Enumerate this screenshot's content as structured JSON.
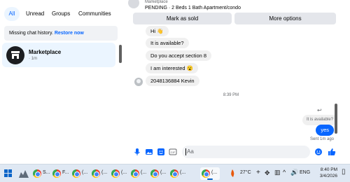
{
  "filters": {
    "all": "All",
    "unread": "Unread",
    "groups": "Groups",
    "communities": "Communities"
  },
  "notice": {
    "text": "Missing chat history.",
    "link": "Restore now"
  },
  "conversation": {
    "name": "Marketplace",
    "time": "· 1m"
  },
  "chat": {
    "title": "Marketplace",
    "listing": "PENDING · 2 Beds 1 Bath Apartment/condo",
    "mark_sold": "Mark as sold",
    "more_options": "More options",
    "messages": [
      "Hi 👋",
      "It is available?",
      "Do you accept section 8",
      "I am interested 😮",
      "2048136884 Kevin"
    ],
    "timestamp": "8:39 PM",
    "quoted": "It is available?",
    "my_reply": "yes",
    "sent": "Sent 1m ago",
    "placeholder": "Aa"
  },
  "taskbar": {
    "apps": [
      "S...",
      "F...",
      "(...",
      "(...",
      "(...",
      "(...",
      "(...",
      "(...",
      "(..."
    ],
    "weather": "27°C",
    "language": "ENG",
    "time": "8:40 PM",
    "date": "3/4/2026"
  },
  "colors": {
    "accent": "#0866ff",
    "bubble": "#f0f0f0"
  }
}
